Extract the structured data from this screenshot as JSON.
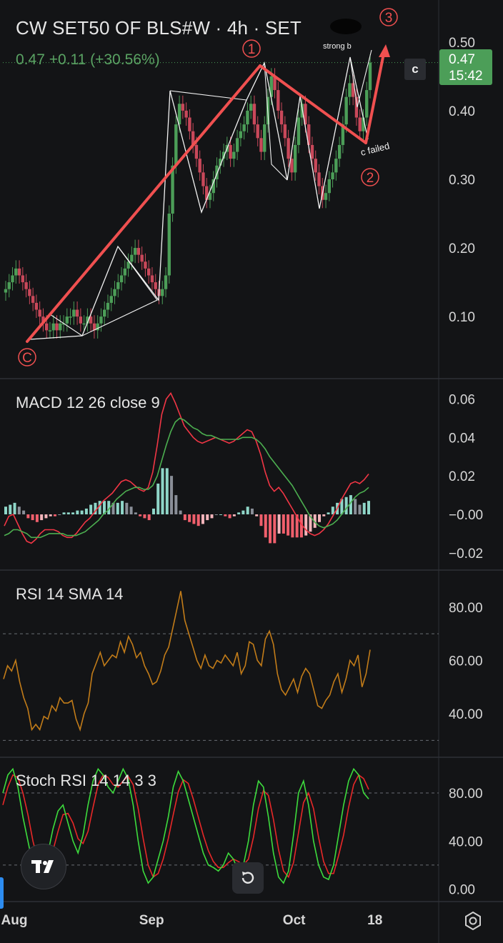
{
  "header": {
    "title": "CW SET50 OF BLS#W · 4h · SET",
    "change": "0.47  +0.11 (+30.56%)",
    "badge_c": "c",
    "last_price": "0.47",
    "countdown": "15:42"
  },
  "x_axis_labels": [
    {
      "label": "Aug",
      "day": 0
    },
    {
      "label": "Sep",
      "day": 31
    },
    {
      "label": "Oct",
      "day": 61
    },
    {
      "label": "18",
      "day": 78
    }
  ],
  "annotations": {
    "wave_c": "C",
    "wave_1": "1",
    "wave_2": "2",
    "wave_3": "3",
    "strong_b": "strong b",
    "c_failed": "c failed"
  },
  "chart_data": [
    {
      "type": "candlestick",
      "title": "CW SET50 OF BLS#W · 4h · SET",
      "x_unit": "days since Aug 1",
      "ylim": [
        0.02,
        0.53
      ],
      "y_ticks": [
        0.1,
        0.2,
        0.3,
        0.4,
        0.5
      ],
      "y_tick_labels": [
        "0.10",
        "0.20",
        "0.30",
        "0.40",
        "0.50"
      ],
      "grid": false,
      "last_price": 0.47,
      "close": [
        0.14,
        0.15,
        0.16,
        0.17,
        0.16,
        0.15,
        0.14,
        0.13,
        0.12,
        0.11,
        0.1,
        0.09,
        0.08,
        0.08,
        0.09,
        0.08,
        0.09,
        0.09,
        0.1,
        0.1,
        0.11,
        0.1,
        0.09,
        0.09,
        0.1,
        0.09,
        0.08,
        0.09,
        0.1,
        0.11,
        0.12,
        0.13,
        0.14,
        0.15,
        0.16,
        0.17,
        0.18,
        0.19,
        0.2,
        0.19,
        0.18,
        0.17,
        0.16,
        0.15,
        0.14,
        0.13,
        0.14,
        0.16,
        0.25,
        0.32,
        0.38,
        0.41,
        0.4,
        0.39,
        0.37,
        0.35,
        0.33,
        0.31,
        0.29,
        0.27,
        0.28,
        0.3,
        0.32,
        0.33,
        0.34,
        0.35,
        0.33,
        0.34,
        0.36,
        0.37,
        0.38,
        0.4,
        0.41,
        0.38,
        0.36,
        0.34,
        0.38,
        0.42,
        0.45,
        0.43,
        0.4,
        0.38,
        0.36,
        0.33,
        0.31,
        0.35,
        0.39,
        0.41,
        0.38,
        0.35,
        0.33,
        0.31,
        0.29,
        0.27,
        0.28,
        0.3,
        0.31,
        0.33,
        0.35,
        0.38,
        0.42,
        0.44,
        0.42,
        0.39,
        0.37,
        0.39,
        0.43,
        0.47
      ]
    },
    {
      "type": "line",
      "title": "MACD 12 26 close 9",
      "ylim": [
        -0.026,
        0.065
      ],
      "y_ticks": [
        0.06,
        0.04,
        0.02,
        0.0,
        -0.02
      ],
      "y_tick_labels": [
        "0.06",
        "0.04",
        "0.02",
        "−0.00",
        "−0.02"
      ],
      "series": [
        {
          "name": "MACD",
          "color": "#f23645",
          "values": [
            -0.006,
            -0.001,
            0.0,
            -0.005,
            -0.01,
            -0.014,
            -0.015,
            -0.013,
            -0.01,
            -0.008,
            -0.008,
            -0.008,
            -0.009,
            -0.011,
            -0.012,
            -0.012,
            -0.01,
            -0.007,
            -0.004,
            -0.002,
            0.001,
            0.004,
            0.007,
            0.009,
            0.011,
            0.014,
            0.017,
            0.018,
            0.017,
            0.015,
            0.013,
            0.012,
            0.014,
            0.022,
            0.036,
            0.052,
            0.06,
            0.063,
            0.058,
            0.052,
            0.046,
            0.043,
            0.04,
            0.038,
            0.037,
            0.038,
            0.039,
            0.04,
            0.039,
            0.038,
            0.037,
            0.038,
            0.04,
            0.042,
            0.044,
            0.043,
            0.038,
            0.031,
            0.022,
            0.015,
            0.012,
            0.014,
            0.011,
            0.007,
            0.003,
            -0.001,
            -0.005,
            -0.008,
            -0.01,
            -0.011,
            -0.01,
            -0.008,
            -0.005,
            -0.001,
            0.003,
            0.008,
            0.012,
            0.016,
            0.017,
            0.016,
            0.018,
            0.021
          ]
        },
        {
          "name": "Signal",
          "color": "#22ab94",
          "values": [
            -0.011,
            -0.01,
            -0.008,
            -0.008,
            -0.009,
            -0.01,
            -0.012,
            -0.012,
            -0.012,
            -0.011,
            -0.01,
            -0.01,
            -0.01,
            -0.01,
            -0.011,
            -0.011,
            -0.011,
            -0.01,
            -0.009,
            -0.007,
            -0.005,
            -0.003,
            0.0,
            0.002,
            0.005,
            0.008,
            0.01,
            0.012,
            0.013,
            0.014,
            0.014,
            0.013,
            0.013,
            0.015,
            0.02,
            0.028,
            0.036,
            0.043,
            0.048,
            0.05,
            0.049,
            0.047,
            0.045,
            0.044,
            0.042,
            0.041,
            0.041,
            0.04,
            0.039,
            0.039,
            0.039,
            0.039,
            0.039,
            0.04,
            0.04,
            0.04,
            0.039,
            0.037,
            0.034,
            0.03,
            0.027,
            0.024,
            0.021,
            0.018,
            0.015,
            0.011,
            0.007,
            0.003,
            -0.001,
            -0.004,
            -0.006,
            -0.007,
            -0.006,
            -0.005,
            -0.003,
            0.0,
            0.003,
            0.006,
            0.009,
            0.011,
            0.012,
            0.014
          ]
        }
      ],
      "histogram": [
        0.004,
        0.005,
        0.006,
        0.004,
        0.002,
        -0.002,
        -0.003,
        -0.004,
        -0.003,
        -0.002,
        -0.001,
        -0.001,
        0.0,
        0.001,
        0.001,
        0.001,
        0.002,
        0.002,
        0.003,
        0.005,
        0.006,
        0.007,
        0.007,
        0.007,
        0.006,
        0.006,
        0.007,
        0.006,
        0.004,
        0.001,
        -0.001,
        -0.002,
        -0.003,
        0.003,
        0.016,
        0.024,
        0.024,
        0.02,
        0.01,
        0.002,
        -0.003,
        -0.004,
        -0.005,
        -0.006,
        -0.005,
        -0.003,
        -0.002,
        0.0,
        0.0,
        -0.001,
        -0.002,
        -0.001,
        0.001,
        0.002,
        0.004,
        0.003,
        -0.001,
        -0.006,
        -0.012,
        -0.015,
        -0.015,
        -0.01,
        -0.01,
        -0.011,
        -0.012,
        -0.012,
        -0.012,
        -0.011,
        -0.009,
        -0.007,
        -0.004,
        -0.001,
        0.001,
        0.004,
        0.006,
        0.008,
        0.009,
        0.01,
        0.008,
        0.005,
        0.006,
        0.007
      ]
    },
    {
      "type": "line",
      "title": "RSI 14 SMA 14",
      "ylim": [
        25,
        92
      ],
      "y_ticks": [
        80,
        60,
        40
      ],
      "y_tick_labels": [
        "80.00",
        "60.00",
        "40.00"
      ],
      "bands": [
        70,
        30
      ],
      "series": [
        {
          "name": "RSI",
          "color": "#c27c19",
          "values": [
            53,
            58,
            56,
            60,
            52,
            46,
            42,
            34,
            36,
            34,
            39,
            38,
            43,
            41,
            46,
            44,
            44,
            45,
            38,
            34,
            40,
            44,
            55,
            59,
            63,
            58,
            60,
            62,
            61,
            67,
            63,
            69,
            66,
            61,
            63,
            58,
            55,
            51,
            52,
            56,
            62,
            65,
            72,
            79,
            86,
            75,
            70,
            65,
            60,
            57,
            62,
            58,
            57,
            60,
            59,
            62,
            60,
            58,
            63,
            55,
            58,
            67,
            66,
            60,
            58,
            68,
            71,
            66,
            55,
            49,
            47,
            50,
            53,
            48,
            54,
            57,
            55,
            49,
            43,
            42,
            45,
            47,
            52,
            55,
            48,
            53,
            60,
            58,
            62,
            50,
            55,
            64
          ]
        }
      ]
    },
    {
      "type": "line",
      "title": "Stoch RSI 14 14 3 3",
      "ylim": [
        -8,
        105
      ],
      "y_ticks": [
        80,
        40,
        0
      ],
      "y_tick_labels": [
        "80.00",
        "40.00",
        "0.00"
      ],
      "bands": [
        80,
        20
      ],
      "series": [
        {
          "name": "K",
          "color": "#4caf50",
          "values": [
            80,
            95,
            100,
            85,
            60,
            40,
            20,
            10,
            15,
            30,
            50,
            65,
            70,
            55,
            40,
            30,
            45,
            70,
            90,
            100,
            95,
            85,
            80,
            90,
            100,
            92,
            70,
            40,
            15,
            5,
            10,
            25,
            40,
            60,
            85,
            98,
            90,
            75,
            60,
            45,
            30,
            20,
            18,
            15,
            20,
            30,
            25,
            15,
            20,
            40,
            70,
            90,
            85,
            60,
            30,
            10,
            5,
            15,
            45,
            80,
            90,
            70,
            40,
            20,
            10,
            8,
            20,
            45,
            70,
            90,
            100,
            95,
            80,
            75
          ]
        },
        {
          "name": "D",
          "color": "#f23645",
          "values": [
            70,
            85,
            95,
            93,
            80,
            62,
            40,
            24,
            15,
            18,
            32,
            48,
            62,
            63,
            55,
            42,
            38,
            48,
            68,
            87,
            95,
            93,
            87,
            85,
            90,
            94,
            87,
            67,
            42,
            20,
            10,
            13,
            25,
            42,
            62,
            81,
            91,
            88,
            75,
            60,
            45,
            32,
            23,
            18,
            18,
            22,
            25,
            23,
            20,
            25,
            43,
            67,
            82,
            78,
            58,
            33,
            15,
            10,
            22,
            47,
            72,
            80,
            67,
            43,
            23,
            13,
            13,
            28,
            45,
            68,
            87,
            95,
            92,
            83
          ]
        }
      ]
    }
  ]
}
